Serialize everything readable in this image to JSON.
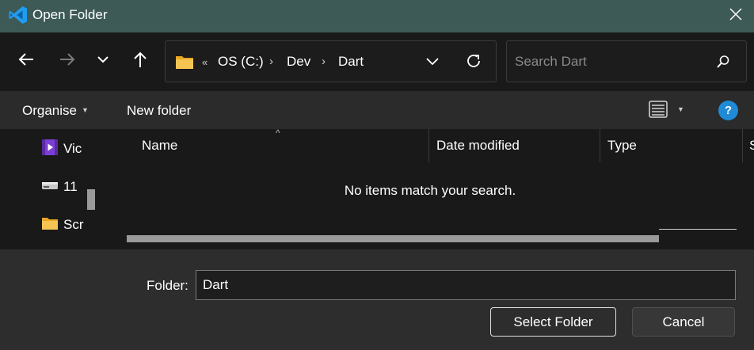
{
  "window": {
    "title": "Open Folder",
    "app_icon": "vscode-icon",
    "close_icon": "close-icon"
  },
  "navigation": {
    "back_icon": "arrow-left-icon",
    "forward_icon": "arrow-right-icon",
    "recent_icon": "chevron-down-icon",
    "up_icon": "arrow-up-icon"
  },
  "address_bar": {
    "overflow": "«",
    "segments": [
      "OS (C:)",
      "Dev",
      "Dart"
    ],
    "separator": "›"
  },
  "search": {
    "placeholder": "Search Dart"
  },
  "toolbar": {
    "organise_label": "Organise",
    "new_folder_label": "New folder",
    "help_label": "?"
  },
  "nav_pane": {
    "items": [
      {
        "label": "Vic",
        "icon": "videos-icon"
      },
      {
        "label": "11",
        "icon": "drive-icon"
      },
      {
        "label": "Scr",
        "icon": "folder-icon"
      }
    ]
  },
  "file_list": {
    "columns": [
      "Name",
      "Date modified",
      "Type",
      "S"
    ],
    "empty_message": "No items match your search."
  },
  "footer": {
    "folder_label": "Folder:",
    "folder_value": "Dart",
    "select_button": "Select Folder",
    "cancel_button": "Cancel"
  },
  "colors": {
    "title_bar": "#3d5a57",
    "accent_blue": "#1f8ad6",
    "folder_yellow": "#f6c453"
  }
}
